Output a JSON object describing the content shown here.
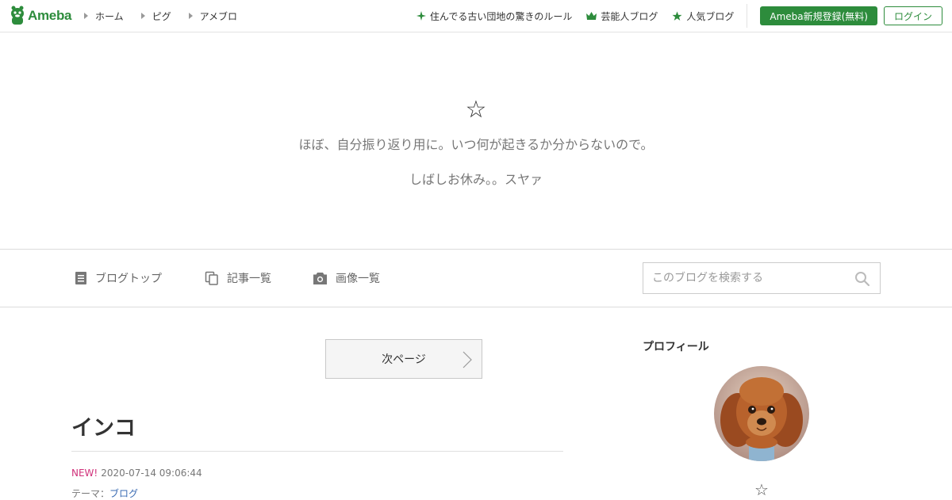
{
  "header": {
    "logo_text": "Ameba",
    "nav": [
      "ホーム",
      "ピグ",
      "アメブロ"
    ],
    "links": [
      {
        "label": "住んでる古い団地の驚きのルール",
        "icon": "sparkle-icon"
      },
      {
        "label": "芸能人ブログ",
        "icon": "crown-icon"
      },
      {
        "label": "人気ブログ",
        "icon": "star-icon"
      }
    ],
    "register_label": "Ameba新規登録(無料)",
    "login_label": "ログイン",
    "brand_color": "#2d8c3c"
  },
  "blog": {
    "title": "☆",
    "description_1": "ほぼ、自分振り返り用に。いつ何が起きるか分からないので。",
    "description_2": "しばしお休み。。スヤァ"
  },
  "subnav": {
    "items": [
      {
        "label": "ブログトップ",
        "icon": "document-icon"
      },
      {
        "label": "記事一覧",
        "icon": "copy-icon"
      },
      {
        "label": "画像一覧",
        "icon": "camera-icon"
      }
    ],
    "search_placeholder": "このブログを検索する"
  },
  "main": {
    "next_page_label": "次ページ",
    "entry": {
      "title": "インコ",
      "new_label": "NEW!",
      "date": "2020-07-14 09:06:44",
      "theme_prefix": "テーマ：",
      "theme": "ブログ"
    }
  },
  "sidebar": {
    "profile_heading": "プロフィール",
    "profile_name": "☆"
  }
}
